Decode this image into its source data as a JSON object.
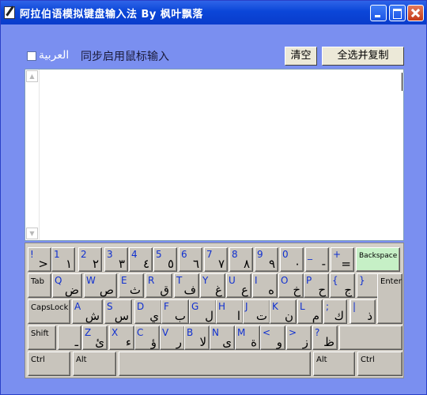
{
  "window": {
    "title": "阿拉伯语模拟键盘输入法 By 枫叶飘落",
    "buttons": {
      "minimize": "minimize-icon",
      "maximize": "maximize-icon",
      "close": "close-icon"
    }
  },
  "toolbar": {
    "arabic_checkbox_label": "العربية",
    "sync_label": "同步启用鼠标输入",
    "clear_label": "清空",
    "copy_label": "全选并复制"
  },
  "editor": {
    "value": "",
    "scroll_up": "▲",
    "scroll_down": "▼"
  },
  "keyboard": {
    "rows": [
      [
        {
          "en": "!",
          "ar": ">"
        },
        {
          "en": "1",
          "ar": "١"
        },
        {
          "en": "2",
          "ar": "٢"
        },
        {
          "en": "3",
          "ar": "٣"
        },
        {
          "en": "4",
          "ar": "٤"
        },
        {
          "en": "5",
          "ar": "٥"
        },
        {
          "en": "6",
          "ar": "٦"
        },
        {
          "en": "7",
          "ar": "٧"
        },
        {
          "en": "8",
          "ar": "٨"
        },
        {
          "en": "9",
          "ar": "٩"
        },
        {
          "en": "0",
          "ar": "٠"
        },
        {
          "en": "_",
          "ar": "-"
        },
        {
          "en": "+",
          "ar": "="
        },
        {
          "label": "Backspace"
        }
      ],
      [
        {
          "label": "Tab"
        },
        {
          "en": "Q",
          "ar": "ض"
        },
        {
          "en": "W",
          "ar": "ص"
        },
        {
          "en": "E",
          "ar": "ث"
        },
        {
          "en": "R",
          "ar": "ق"
        },
        {
          "en": "T",
          "ar": "ف"
        },
        {
          "en": "Y",
          "ar": "غ"
        },
        {
          "en": "U",
          "ar": "ع"
        },
        {
          "en": "I",
          "ar": "ه"
        },
        {
          "en": "O",
          "ar": "خ"
        },
        {
          "en": "P",
          "ar": "ح"
        },
        {
          "en": "{",
          "ar": "ج"
        },
        {
          "en": "}",
          "ar": "د"
        },
        {
          "label": "EnterEnter"
        }
      ],
      [
        {
          "label": "CapsLock"
        },
        {
          "en": "A",
          "ar": "ش"
        },
        {
          "en": "S",
          "ar": "س"
        },
        {
          "en": "D",
          "ar": "ي"
        },
        {
          "en": "F",
          "ar": "ب"
        },
        {
          "en": "G",
          "ar": "ل"
        },
        {
          "en": "H",
          "ar": "ا"
        },
        {
          "en": "J",
          "ar": "ت"
        },
        {
          "en": "K",
          "ar": "ن"
        },
        {
          "en": "L",
          "ar": "م"
        },
        {
          "en": ";",
          "ar": "ك"
        },
        {
          "en": "'",
          "ar": "ط"
        },
        {
          "en": "|",
          "ar": "ذ"
        }
      ],
      [
        {
          "label": "Shift"
        },
        {
          "en": "",
          "ar": "ـ"
        },
        {
          "en": "Z",
          "ar": "ئ"
        },
        {
          "en": "X",
          "ar": "ء"
        },
        {
          "en": "C",
          "ar": "ؤ"
        },
        {
          "en": "V",
          "ar": "ر"
        },
        {
          "en": "B",
          "ar": "لا"
        },
        {
          "en": "N",
          "ar": "ى"
        },
        {
          "en": "M",
          "ar": "ة"
        },
        {
          "en": "<",
          "ar": "و"
        },
        {
          "en": ">",
          "ar": "ز"
        },
        {
          "en": "?",
          "ar": "ظ"
        },
        {
          "label": ""
        }
      ],
      [
        {
          "label": "Ctrl"
        },
        {
          "label": "Alt"
        },
        {
          "label": ""
        },
        {
          "label": "Alt"
        },
        {
          "label": "Ctrl"
        }
      ]
    ]
  }
}
